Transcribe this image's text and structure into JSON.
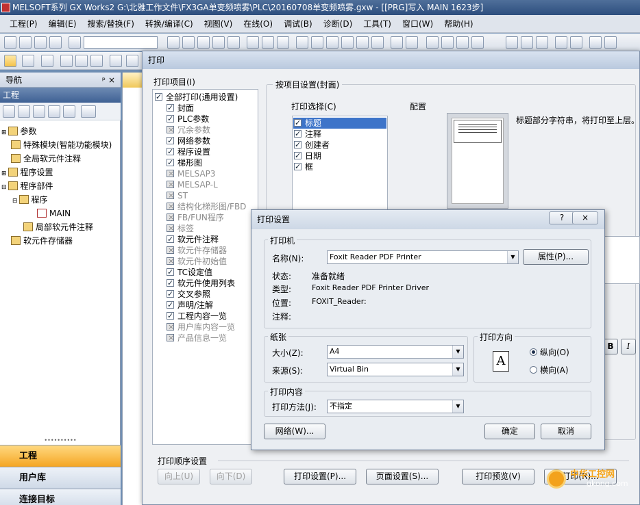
{
  "window": {
    "title": "MELSOFT系列 GX Works2 G:\\北雅工作文件\\FX3GA单变频喷雾\\PLC\\20160708单变频喷雾.gxw - [[PRG]写入 MAIN 1623步]"
  },
  "menu": [
    "工程(P)",
    "编辑(E)",
    "搜索/替换(F)",
    "转换/编译(C)",
    "视图(V)",
    "在线(O)",
    "调试(B)",
    "诊断(D)",
    "工具(T)",
    "窗口(W)",
    "帮助(H)"
  ],
  "nav": {
    "header": "导航",
    "pin": "ᵖ",
    "close": "×",
    "section": "工程",
    "tree": [
      "参数",
      "特殊模块(智能功能模块)",
      "全局软元件注释",
      "程序设置",
      "程序部件",
      "程序",
      "MAIN",
      "局部软元件注释",
      "软元件存储器"
    ],
    "tabs": [
      "工程",
      "用户库",
      "连接目标"
    ]
  },
  "print_dialog": {
    "title": "打印",
    "items_label": "打印项目(I)",
    "items": [
      {
        "label": "全部打印(通用设置)",
        "checked": true
      },
      {
        "label": "封面",
        "checked": true
      },
      {
        "label": "PLC参数",
        "checked": true
      },
      {
        "label": "冗余参数",
        "checked": false
      },
      {
        "label": "网络参数",
        "checked": true
      },
      {
        "label": "程序设置",
        "checked": true
      },
      {
        "label": "梯形图",
        "checked": true
      },
      {
        "label": "MELSAP3",
        "checked": false
      },
      {
        "label": "MELSAP-L",
        "checked": false
      },
      {
        "label": "ST",
        "checked": false
      },
      {
        "label": "结构化梯形图/FBD",
        "checked": false
      },
      {
        "label": "FB/FUN程序",
        "checked": false
      },
      {
        "label": "标签",
        "checked": false
      },
      {
        "label": "软元件注释",
        "checked": true
      },
      {
        "label": "软元件存储器",
        "checked": false
      },
      {
        "label": "软元件初始值",
        "checked": false
      },
      {
        "label": "TC设定值",
        "checked": true
      },
      {
        "label": "软元件使用列表",
        "checked": true
      },
      {
        "label": "交叉参照",
        "checked": true
      },
      {
        "label": "声明/注解",
        "checked": true
      },
      {
        "label": "工程内容一览",
        "checked": true
      },
      {
        "label": "用户库内容一览",
        "checked": false
      },
      {
        "label": "产品信息一览",
        "checked": false
      }
    ],
    "item_settings_label": "按项目设置(封面)",
    "print_select_label": "打印选择(C)",
    "print_select": [
      "标题",
      "注释",
      "创建者",
      "日期",
      "框"
    ],
    "layout_label": "配置",
    "layout_desc": "标题部分字符串，将打印至上层。",
    "order_label": "打印顺序设置",
    "buttons": {
      "up": "向上(U)",
      "down": "向下(D)",
      "setup": "打印设置(P)...",
      "page_setup": "页面设置(S)...",
      "preview": "打印预览(V)",
      "print": "打印(R)..."
    },
    "format_bold": "B",
    "format_italic": "I"
  },
  "setup_dialog": {
    "title": "打印设置",
    "help": "?",
    "close": "×",
    "printer_group": "打印机",
    "name_label": "名称(N):",
    "name_value": "Foxit Reader PDF Printer",
    "properties": "属性(P)...",
    "status_label": "状态:",
    "status_value": "准备就绪",
    "type_label": "类型:",
    "type_value": "Foxit Reader PDF Printer Driver",
    "where_label": "位置:",
    "where_value": "FOXIT_Reader:",
    "comment_label": "注释:",
    "paper_group": "纸张",
    "size_label": "大小(Z):",
    "size_value": "A4",
    "source_label": "来源(S):",
    "source_value": "Virtual Bin",
    "orientation_group": "打印方向",
    "orientation_letter": "A",
    "portrait": "纵向(O)",
    "landscape": "横向(A)",
    "orientation_selected": "portrait",
    "content_group": "打印内容",
    "method_label": "打印方法(J):",
    "method_value": "不指定",
    "network": "网络(W)...",
    "ok": "确定",
    "cancel": "取消"
  },
  "watermark": {
    "text": "中华工控网",
    "url": "gkong.com"
  }
}
